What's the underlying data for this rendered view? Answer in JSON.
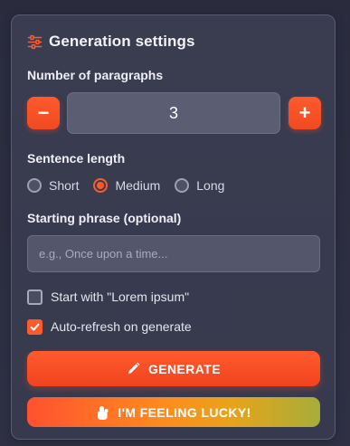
{
  "panel": {
    "title": "Generation settings",
    "title_icon": "sliders-icon"
  },
  "paragraphs": {
    "label": "Number of paragraphs",
    "value": "3",
    "decrement_symbol": "−",
    "increment_symbol": "+"
  },
  "sentence_length": {
    "label": "Sentence length",
    "options": [
      {
        "label": "Short",
        "selected": false
      },
      {
        "label": "Medium",
        "selected": true
      },
      {
        "label": "Long",
        "selected": false
      }
    ]
  },
  "starting_phrase": {
    "label": "Starting phrase (optional)",
    "value": "",
    "placeholder": "e.g., Once upon a time..."
  },
  "options": {
    "lorem_label": "Start with \"Lorem ipsum\"",
    "lorem_checked": false,
    "autorefresh_label": "Auto-refresh on generate",
    "autorefresh_checked": true
  },
  "actions": {
    "generate_label": "GENERATE",
    "generate_icon": "pencil-icon",
    "lucky_label": "I'M FEELING LUCKY!",
    "lucky_icon": "hand-icon"
  },
  "colors": {
    "accent": "#ff5a2c",
    "panel_bg": "#3a3c50",
    "page_bg": "#2a2b3d"
  }
}
